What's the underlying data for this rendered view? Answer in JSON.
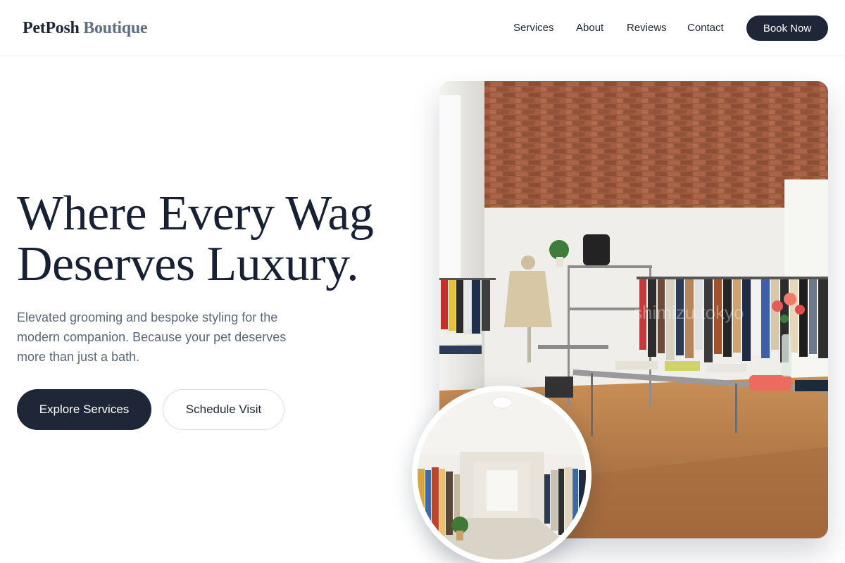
{
  "header": {
    "logo_brand": "PetPosh",
    "logo_sub": "Boutique",
    "nav": [
      "Services",
      "About",
      "Reviews",
      "Contact"
    ],
    "cta_label": "Book Now"
  },
  "hero": {
    "title_line1": "Where Every Wag",
    "title_line2": "Deserves Luxury.",
    "subtitle": "Elevated grooming and bespoke styling for the modern companion. Because your pet deserves more than just a bath.",
    "primary_cta": "Explore Services",
    "secondary_cta": "Schedule Visit"
  },
  "images": {
    "main": "boutique-interior-photo",
    "inset": "boutique-corridor-photo",
    "watermark": "shimizu.tokyo"
  },
  "colors": {
    "primary": "#1e2638",
    "muted_text": "#5b6678",
    "logo_sub": "#5f6e83"
  }
}
